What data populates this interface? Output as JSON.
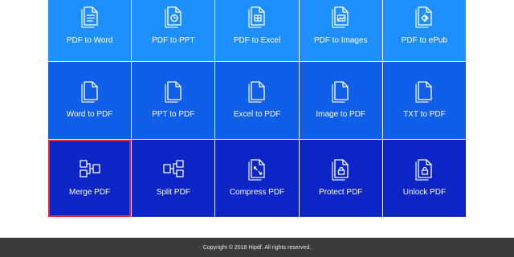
{
  "tools": [
    {
      "label": "PDF to Word",
      "icon": "word-doc-icon",
      "row": 1
    },
    {
      "label": "PDF to PPT",
      "icon": "ppt-doc-icon",
      "row": 1
    },
    {
      "label": "PDF to Excel",
      "icon": "excel-doc-icon",
      "row": 1
    },
    {
      "label": "PDF to Images",
      "icon": "image-doc-icon",
      "row": 1
    },
    {
      "label": "PDF to ePub",
      "icon": "epub-doc-icon",
      "row": 1
    },
    {
      "label": "Word to PDF",
      "icon": "pdf-doc-icon",
      "row": 2
    },
    {
      "label": "PPT to PDF",
      "icon": "pdf-doc-icon",
      "row": 2
    },
    {
      "label": "Excel to PDF",
      "icon": "pdf-doc-icon",
      "row": 2
    },
    {
      "label": "Image to PDF",
      "icon": "pdf-doc-icon",
      "row": 2
    },
    {
      "label": "TXT to PDF",
      "icon": "pdf-doc-icon",
      "row": 2
    },
    {
      "label": "Merge PDF",
      "icon": "merge-icon",
      "row": 3,
      "selected": true
    },
    {
      "label": "Split PDF",
      "icon": "split-icon",
      "row": 3
    },
    {
      "label": "Compress PDF",
      "icon": "compress-icon",
      "row": 3
    },
    {
      "label": "Protect PDF",
      "icon": "lock-doc-icon",
      "row": 3
    },
    {
      "label": "Unlock PDF",
      "icon": "unlock-doc-icon",
      "row": 3
    }
  ],
  "footer": {
    "copyright": "Copyright © 2018 Hipdf. All rights reserved."
  },
  "colors": {
    "row1": "#1e8fff",
    "row2": "#0f5fe8",
    "row3": "#0b25c6",
    "selection": "#e0223a",
    "footer": "#3b3b3b"
  }
}
